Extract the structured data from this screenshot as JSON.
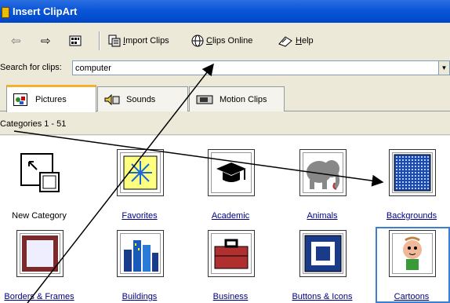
{
  "window": {
    "title": "Insert ClipArt"
  },
  "toolbar": {
    "back_glyph": "⇦",
    "forward_glyph": "⇨",
    "import_label_u": "I",
    "import_label_rest": "mport Clips",
    "online_label_u": "C",
    "online_label_rest": "lips Online",
    "help_label_u": "H",
    "help_label_rest": "elp"
  },
  "search": {
    "label": "Search for clips:",
    "value": "computer"
  },
  "tabs": [
    {
      "label": "Pictures"
    },
    {
      "label": "Sounds"
    },
    {
      "label": "Motion Clips"
    }
  ],
  "category_header": "Categories 1 - 51",
  "categories": [
    {
      "label": "New Category",
      "icon": "new-category-icon"
    },
    {
      "label": "Favorites",
      "icon": "star-icon"
    },
    {
      "label": "Academic",
      "icon": "graduation-cap-icon"
    },
    {
      "label": "Animals",
      "icon": "elephant-icon"
    },
    {
      "label": "Backgrounds",
      "icon": "grid-pattern-icon"
    },
    {
      "label": "Borders & Frames",
      "icon": "frame-icon"
    },
    {
      "label": "Buildings",
      "icon": "city-icon"
    },
    {
      "label": "Business",
      "icon": "briefcase-icon"
    },
    {
      "label": "Buttons & Icons",
      "icon": "button-icon"
    },
    {
      "label": "Cartoons",
      "icon": "cartoon-character-icon"
    }
  ],
  "colors": {
    "titlebar": "#0a56d8",
    "selection": "#3c7fd0",
    "link": "#000080"
  }
}
